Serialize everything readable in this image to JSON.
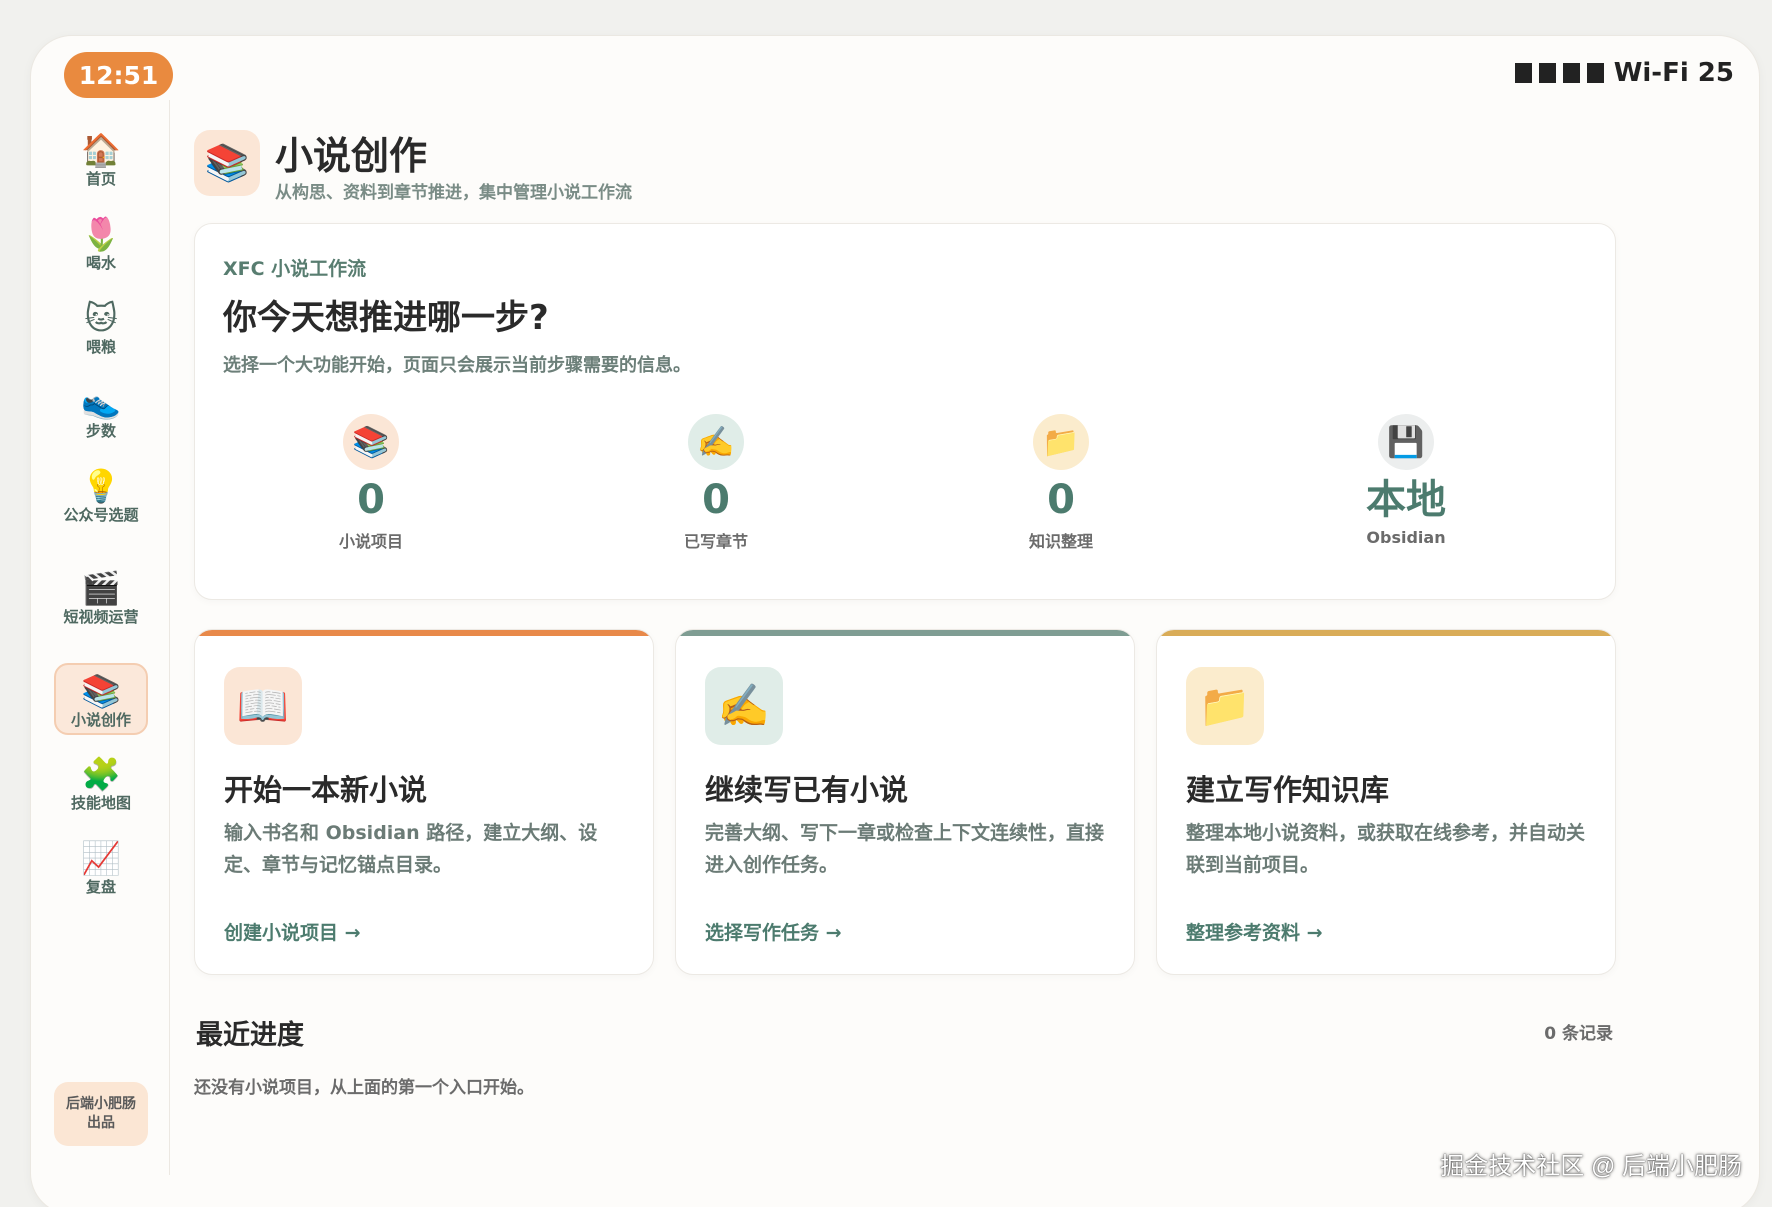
{
  "status_bar": {
    "time": "12:51",
    "network": "Wi-Fi 25"
  },
  "sidebar": {
    "items": [
      {
        "icon": "🏠",
        "icon_name": "house-icon",
        "label": "首页"
      },
      {
        "icon": "🌷",
        "icon_name": "tulip-icon",
        "label": "喝水"
      },
      {
        "icon": "🐱",
        "icon_name": "cat-icon",
        "label": "喂粮"
      },
      {
        "icon": "👟",
        "icon_name": "shoe-icon",
        "label": "步数"
      },
      {
        "icon": "💡",
        "icon_name": "lightbulb-icon",
        "label": "公众号选题"
      },
      {
        "icon": "🎬",
        "icon_name": "clapperboard-icon",
        "label": "短视频运营"
      },
      {
        "icon": "📚",
        "icon_name": "books-icon",
        "label": "小说创作",
        "active": true
      },
      {
        "icon": "🧩",
        "icon_name": "puzzle-icon",
        "label": "技能地图"
      },
      {
        "icon": "📈",
        "icon_name": "chart-icon",
        "label": "复盘"
      }
    ],
    "brand_badge": "后端小肥肠出品"
  },
  "header": {
    "icon": "📚",
    "title": "小说创作",
    "subtitle": "从构思、资料到章节推进，集中管理小说工作流"
  },
  "hero": {
    "kicker": "XFC 小说工作流",
    "title": "你今天想推进哪一步?",
    "description": "选择一个大功能开始，页面只会展示当前步骤需要的信息。",
    "stats": [
      {
        "icon": "📚",
        "icon_name": "books-icon",
        "value": "0",
        "label": "小说项目",
        "bg": "#fbe6d6"
      },
      {
        "icon": "✍️",
        "icon_name": "writing-hand-icon",
        "value": "0",
        "label": "已写章节",
        "bg": "#e0ede8"
      },
      {
        "icon": "📁",
        "icon_name": "folder-icon",
        "value": "0",
        "label": "知识整理",
        "bg": "#fbeccd"
      },
      {
        "icon": "💾",
        "icon_name": "floppy-disk-icon",
        "value": "本地",
        "label": "Obsidian",
        "bg": "#eceeee"
      }
    ]
  },
  "cards": [
    {
      "icon": "📖",
      "icon_name": "open-book-icon",
      "icon_bg": "#fbe6d6",
      "accent": "#e8894a",
      "title": "开始一本新小说",
      "description": "输入书名和 Obsidian 路径，建立大纲、设定、章节与记忆锚点目录。",
      "link": "创建小说项目 →"
    },
    {
      "icon": "✍️",
      "icon_name": "writing-hand-icon",
      "icon_bg": "#e0ede8",
      "accent": "#7f9d93",
      "title": "继续写已有小说",
      "description": "完善大纲、写下一章或检查上下文连续性，直接进入创作任务。",
      "link": "选择写作任务 →"
    },
    {
      "icon": "📁",
      "icon_name": "folder-icon",
      "icon_bg": "#fbeccd",
      "accent": "#d9ac58",
      "title": "建立写作知识库",
      "description": "整理本地小说资料，或获取在线参考，并自动关联到当前项目。",
      "link": "整理参考资料 →"
    }
  ],
  "recent": {
    "title": "最近进度",
    "count": "0 条记录",
    "empty": "还没有小说项目，从上面的第一个入口开始。"
  },
  "watermark": "掘金技术社区 @ 后端小肥肠"
}
